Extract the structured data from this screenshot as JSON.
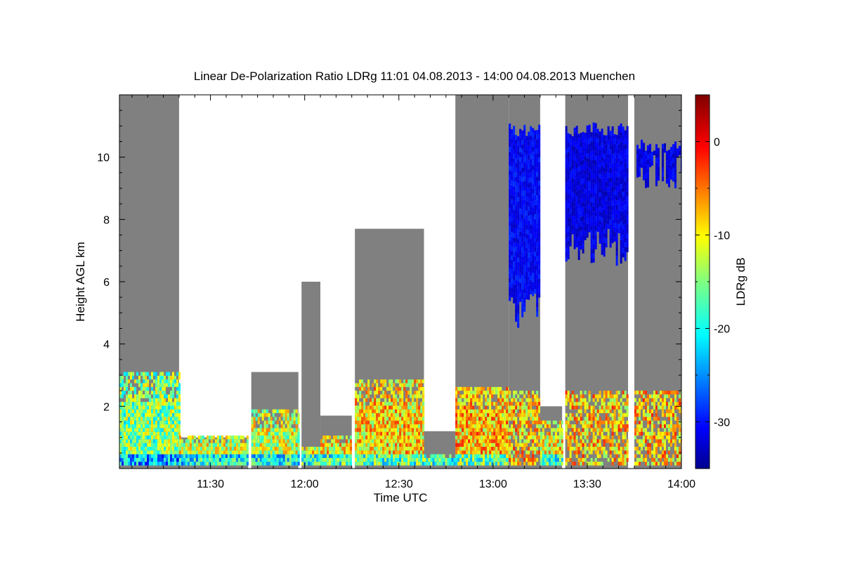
{
  "chart_data": {
    "type": "heatmap",
    "title": "Linear De-Polarization Ratio LDRg   11:01 04.08.2013 - 14:00 04.08.2013 Muenchen",
    "xlabel": "Time UTC",
    "ylabel": "Height AGL km",
    "xlim": [
      "11:01",
      "14:00"
    ],
    "ylim": [
      0,
      12
    ],
    "x_ticks": [
      "11:30",
      "12:00",
      "12:30",
      "13:00",
      "13:30",
      "14:00"
    ],
    "y_ticks": [
      2,
      4,
      6,
      8,
      10
    ],
    "colorbar": {
      "label": "LDRg dB",
      "range": [
        -35,
        5
      ],
      "ticks": [
        0,
        -10,
        -20,
        -30
      ],
      "colormap": "jet"
    },
    "no_signal_color": "#808080",
    "segments": [
      {
        "start": "11:01",
        "end": "11:20",
        "top_km": 12,
        "aerosol_top_km": 3.0,
        "mean_ldr_db": -15
      },
      {
        "start": "11:20",
        "end": "11:42",
        "top_km": 1.0,
        "aerosol_top_km": 1.0,
        "mean_ldr_db": -12
      },
      {
        "start": "11:43",
        "end": "11:58",
        "top_km": 3.1,
        "aerosol_top_km": 1.8,
        "mean_ldr_db": -12
      },
      {
        "start": "11:59",
        "end": "12:05",
        "top_km": 6.0,
        "aerosol_top_km": 0.7,
        "mean_ldr_db": -10
      },
      {
        "start": "12:05",
        "end": "12:15",
        "top_km": 1.7,
        "aerosol_top_km": 1.0,
        "mean_ldr_db": -10
      },
      {
        "start": "12:16",
        "end": "12:38",
        "top_km": 7.7,
        "aerosol_top_km": 2.8,
        "mean_ldr_db": -9
      },
      {
        "start": "12:38",
        "end": "12:48",
        "top_km": 1.2,
        "aerosol_top_km": 0.4,
        "mean_ldr_db": -10
      },
      {
        "start": "12:48",
        "end": "13:05",
        "top_km": 12,
        "aerosol_top_km": 2.6,
        "mean_ldr_db": -8
      },
      {
        "start": "13:05",
        "end": "13:15",
        "top_km": 12,
        "cirrus_km": [
          4.5,
          11.0
        ],
        "mean_ldr_db": -30
      },
      {
        "start": "13:15",
        "end": "13:22",
        "top_km": 2.0,
        "aerosol_top_km": 1.5,
        "mean_ldr_db": -10
      },
      {
        "start": "13:23",
        "end": "13:43",
        "top_km": 12,
        "cirrus_km": [
          6.5,
          11.0
        ],
        "mean_ldr_db": -31
      },
      {
        "start": "13:45",
        "end": "14:00",
        "top_km": 12,
        "cirrus_km": [
          9.0,
          10.5
        ],
        "mean_ldr_db": -31
      }
    ]
  }
}
